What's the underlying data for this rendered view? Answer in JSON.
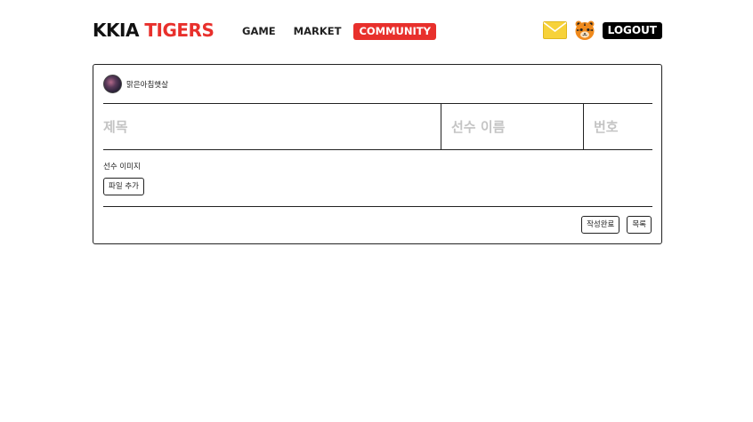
{
  "header": {
    "logo_part1": "KKIA",
    "logo_part2": "TIGERS",
    "nav": [
      {
        "label": "GAME"
      },
      {
        "label": "MARKET"
      },
      {
        "label": "COMMUNITY",
        "active": true
      }
    ],
    "mail_icon": "envelope-icon",
    "profile_icon": "tiger-icon",
    "logout_label": "LOGOUT"
  },
  "colors": {
    "brand_red": "#e8302c",
    "mail_yellow": "#f7d23a",
    "tiger_orange": "#f08a1c",
    "border": "#222222",
    "placeholder": "#c4c4c4"
  },
  "post": {
    "author_name": "맑은아침햇살",
    "title_placeholder": "제목",
    "player_placeholder": "선수 이름",
    "number_placeholder": "번호",
    "image_label": "선수 이미지",
    "file_button": "파일 추가",
    "submit_label": "작성완료",
    "list_label": "목록"
  }
}
